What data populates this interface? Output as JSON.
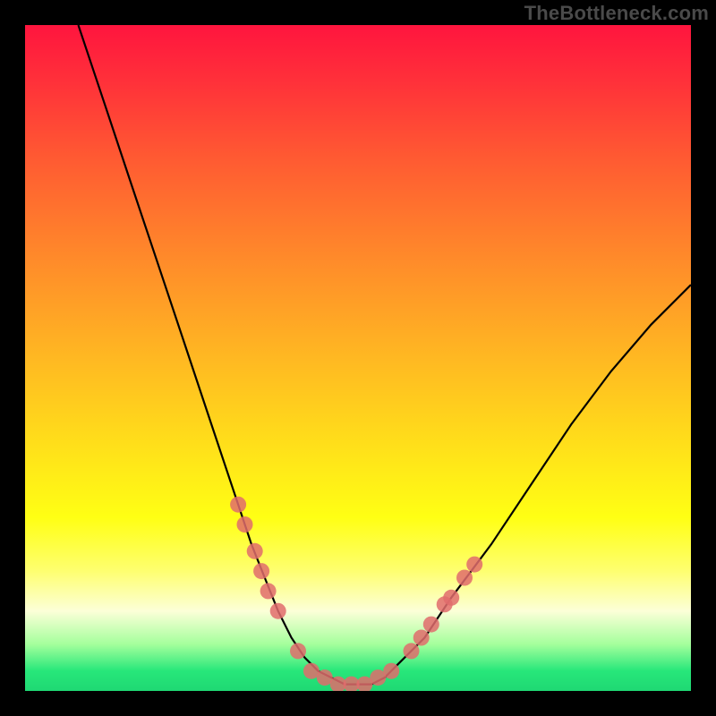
{
  "watermark": {
    "text": "TheBottleneck.com"
  },
  "chart_data": {
    "type": "line",
    "title": "",
    "xlabel": "",
    "ylabel": "",
    "xlim": [
      0,
      100
    ],
    "ylim": [
      0,
      100
    ],
    "series": [
      {
        "name": "bottleneck-curve",
        "x": [
          8,
          12,
          16,
          20,
          24,
          28,
          32,
          34,
          36,
          38,
          40,
          42,
          44,
          46,
          48,
          50,
          52,
          54,
          56,
          60,
          64,
          70,
          76,
          82,
          88,
          94,
          100
        ],
        "y": [
          100,
          88,
          76,
          64,
          52,
          40,
          28,
          22,
          17,
          12,
          8,
          5,
          3,
          2,
          1,
          1,
          1,
          2,
          4,
          8,
          14,
          22,
          31,
          40,
          48,
          55,
          61
        ]
      }
    ],
    "markers": {
      "name": "highlighted-points",
      "color": "#e06c6c",
      "points": [
        {
          "x": 32,
          "y": 28
        },
        {
          "x": 33,
          "y": 25
        },
        {
          "x": 34.5,
          "y": 21
        },
        {
          "x": 35.5,
          "y": 18
        },
        {
          "x": 36.5,
          "y": 15
        },
        {
          "x": 38,
          "y": 12
        },
        {
          "x": 41,
          "y": 6
        },
        {
          "x": 43,
          "y": 3
        },
        {
          "x": 45,
          "y": 2
        },
        {
          "x": 47,
          "y": 1
        },
        {
          "x": 49,
          "y": 1
        },
        {
          "x": 51,
          "y": 1
        },
        {
          "x": 53,
          "y": 2
        },
        {
          "x": 55,
          "y": 3
        },
        {
          "x": 58,
          "y": 6
        },
        {
          "x": 59.5,
          "y": 8
        },
        {
          "x": 61,
          "y": 10
        },
        {
          "x": 63,
          "y": 13
        },
        {
          "x": 64,
          "y": 14
        },
        {
          "x": 66,
          "y": 17
        },
        {
          "x": 67.5,
          "y": 19
        }
      ]
    },
    "gradient_stops": [
      {
        "pos": 0,
        "color": "#ff153e"
      },
      {
        "pos": 50,
        "color": "#ffdf1a"
      },
      {
        "pos": 88,
        "color": "#fcffd8"
      },
      {
        "pos": 100,
        "color": "#1fd873"
      }
    ]
  }
}
